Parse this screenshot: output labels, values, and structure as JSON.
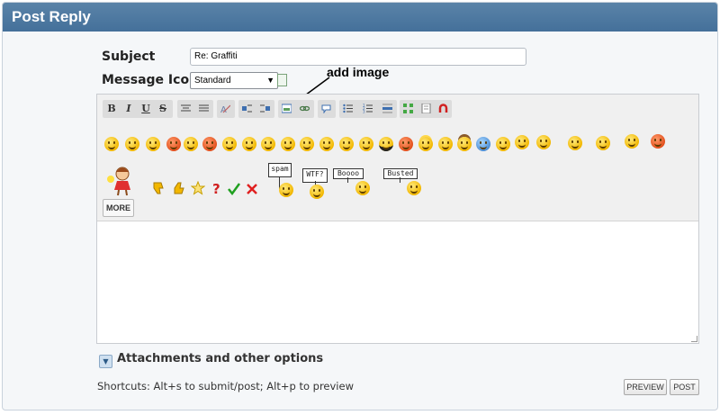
{
  "header": {
    "title": "Post Reply"
  },
  "form": {
    "subject_label": "Subject",
    "subject_value": "Re: Graffiti",
    "icon_label": "Message Icon",
    "icon_value": "Standard"
  },
  "annotation": {
    "text": "add image"
  },
  "toolbar": {
    "bold": "B",
    "italic": "I",
    "underline": "U",
    "strike": "S",
    "more_label": "MORE"
  },
  "signs": [
    "spam",
    "WTF?",
    "Boooo",
    "Busted"
  ],
  "attachments": {
    "label": "Attachments and other options"
  },
  "footer": {
    "shortcuts": "Shortcuts: Alt+s to submit/post; Alt+p to preview",
    "preview_label": "PREVIEW",
    "post_label": "POST"
  }
}
